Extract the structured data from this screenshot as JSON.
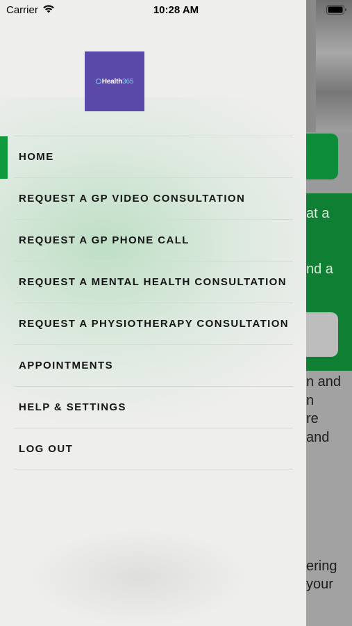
{
  "status_bar": {
    "carrier": "Carrier",
    "time": "10:28 AM"
  },
  "logo": {
    "brand": "Health",
    "accent": "365"
  },
  "menu": {
    "items": [
      {
        "label": "HOME",
        "active": true
      },
      {
        "label": "REQUEST A GP VIDEO CONSULTATION"
      },
      {
        "label": "REQUEST A GP PHONE CALL"
      },
      {
        "label": "REQUEST A MENTAL HEALTH CONSULTATION"
      },
      {
        "label": "REQUEST A PHYSIOTHERAPY CONSULTATION"
      },
      {
        "label": "APPOINTMENTS"
      },
      {
        "label": "HELP & SETTINGS"
      },
      {
        "label": "LOG OUT"
      }
    ]
  },
  "background": {
    "panel_lines": [
      "at a",
      "nd a"
    ],
    "lower_lines": [
      "n and",
      "n",
      "re",
      "and"
    ],
    "bottom_lines": [
      "ering",
      "your"
    ]
  },
  "colors": {
    "brand_green": "#0f9a3e",
    "logo_purple": "#5a49a9",
    "drawer_bg": "#eeeeed"
  }
}
